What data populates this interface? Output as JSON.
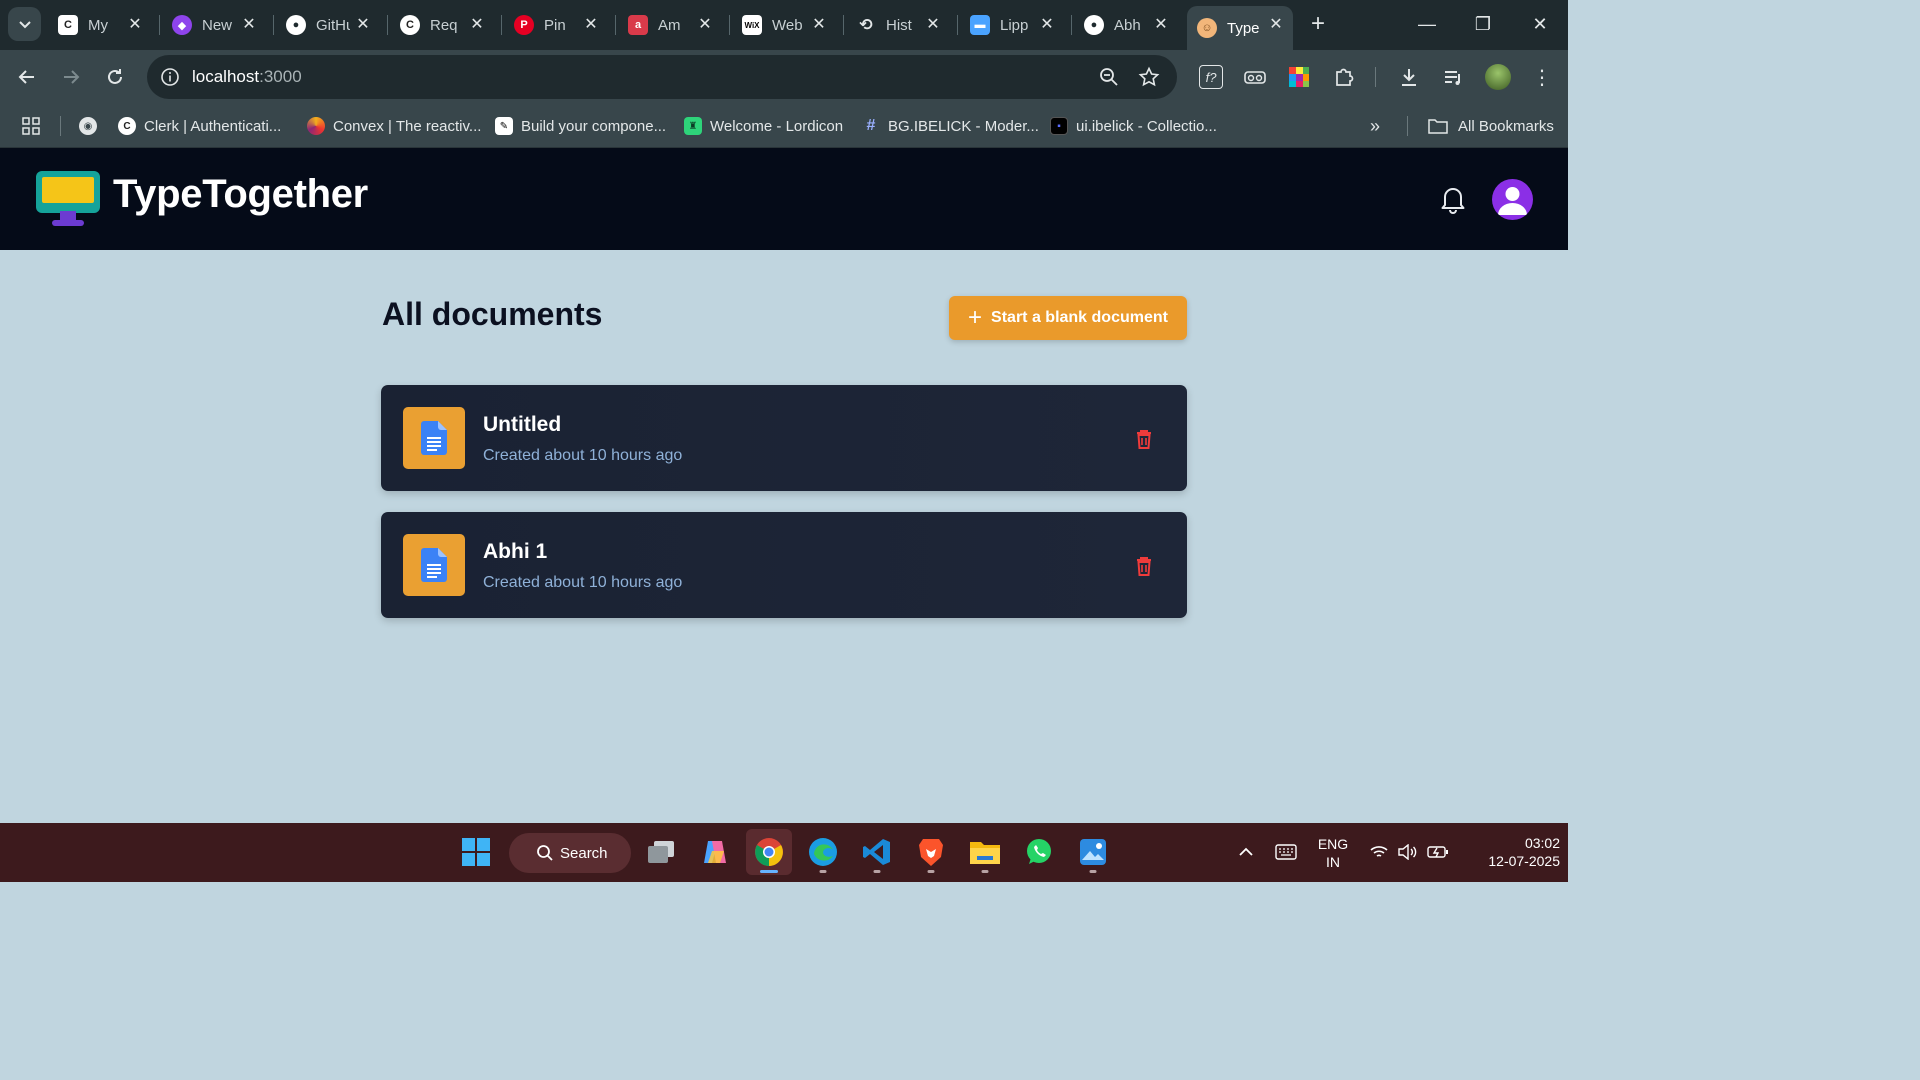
{
  "browser": {
    "tabs": [
      {
        "title": "My",
        "icon": "clerk-icon",
        "color": "#ffffff"
      },
      {
        "title": "New",
        "icon": "convex-icon",
        "color": "#8e44ec"
      },
      {
        "title": "GitHub",
        "icon": "github-icon",
        "color": "#ffffff"
      },
      {
        "title": "Req",
        "icon": "clerk-icon",
        "color": "#ffffff"
      },
      {
        "title": "Pin",
        "icon": "pinterest-icon",
        "color": "#e60023"
      },
      {
        "title": "Am",
        "icon": "amazon-icon",
        "color": "#d93a4a"
      },
      {
        "title": "Web",
        "icon": "wix-icon",
        "color": "#ffffff"
      },
      {
        "title": "Hist",
        "icon": "history-icon",
        "color": "#e3e7e8"
      },
      {
        "title": "Lipp",
        "icon": "lippy-icon",
        "color": "#4aa3ff"
      },
      {
        "title": "Abh",
        "icon": "github-icon",
        "color": "#ffffff"
      },
      {
        "title": "Type",
        "icon": "typetogether-tab-icon",
        "color": "#f2b67a",
        "active": true
      }
    ],
    "url_host": "localhost",
    "url_port": ":3000",
    "bookmarks": [
      {
        "label": "Clerk | Authenticati...",
        "icon": "clerk-icon"
      },
      {
        "label": "Convex | The reactiv...",
        "icon": "convex-icon"
      },
      {
        "label": "Build your compone...",
        "icon": "pencil-icon"
      },
      {
        "label": "Welcome - Lordicon",
        "icon": "lordicon-icon"
      },
      {
        "label": "BG.IBELICK - Moder...",
        "icon": "hash-icon"
      },
      {
        "label": "ui.ibelick - Collectio...",
        "icon": "square-icon"
      }
    ],
    "all_bookmarks_label": "All Bookmarks"
  },
  "app": {
    "brand": "TypeTogether",
    "title": "All documents",
    "new_doc_label": "Start a blank document",
    "accent": "#ea9a2b",
    "documents": [
      {
        "title": "Untitled",
        "meta": "Created about 10 hours ago"
      },
      {
        "title": "Abhi 1",
        "meta": "Created about 10 hours ago"
      }
    ]
  },
  "taskbar": {
    "search_label": "Search",
    "lang_line1": "ENG",
    "lang_line2": "IN",
    "time": "03:02",
    "date": "12-07-2025"
  }
}
